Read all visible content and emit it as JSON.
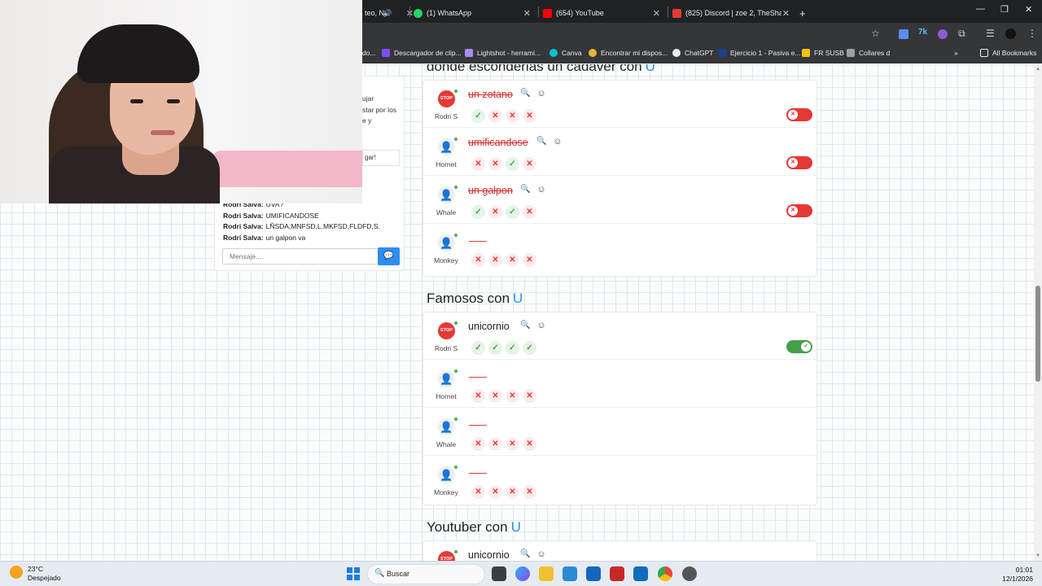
{
  "browser": {
    "tabs": [
      {
        "label": "teo, N"
      },
      {
        "label": "(1) WhatsApp"
      },
      {
        "label": "(654) YouTube"
      },
      {
        "label": "(825) Discord | zoe 2, TheShado"
      }
    ],
    "new_tab": "+",
    "bookmarks": [
      {
        "label": "do..."
      },
      {
        "label": "Descargador de clip..."
      },
      {
        "label": "Lightshot - herrami..."
      },
      {
        "label": "Canva"
      },
      {
        "label": "Encontrar mi dispos..."
      },
      {
        "label": "ChatGPT"
      },
      {
        "label": "Ejercicio 1 - Pasiva e..."
      },
      {
        "label": "FR SUSB"
      },
      {
        "label": "Collares d"
      }
    ],
    "all_bookmarks": "All Bookmarks",
    "colors": {
      "tabbar": "#202124",
      "toolbar": "#35363a"
    }
  },
  "chat": {
    "lines": [
      {
        "user": "Rodri Salva:",
        "text": "UVA?"
      },
      {
        "user": "Rodri Salva:",
        "text": "UMIFICANDOSE"
      },
      {
        "user": "Rodri Salva:",
        "text": "LÑSDA,MNFSD,L.MKFSD,FLDFD,S."
      },
      {
        "user": "Rodri Salva:",
        "text": "un galpon va"
      }
    ],
    "input_placeholder": "Mensaje....",
    "peek_lines": [
      "ujar",
      "star por los",
      "e y"
    ],
    "peek_box": "gar!"
  },
  "sections": [
    {
      "title": "donde esconderias un cadaver con",
      "letter": "U",
      "rows": [
        {
          "player": "Rodri S",
          "answer": "un zotano",
          "status": "rejected",
          "votes": [
            "yes",
            "no",
            "no",
            "no"
          ],
          "toggle": "off"
        },
        {
          "player": "Hornet",
          "answer": "umificandose",
          "status": "rejected",
          "votes": [
            "no",
            "no",
            "yes",
            "no"
          ],
          "toggle": "off"
        },
        {
          "player": "Whale",
          "answer": "un galpon",
          "status": "rejected",
          "votes": [
            "yes",
            "no",
            "yes",
            "no"
          ],
          "toggle": "off"
        },
        {
          "player": "Monkey",
          "answer": "",
          "status": "empty",
          "votes": [
            "no",
            "no",
            "no",
            "no"
          ],
          "toggle": "none"
        }
      ]
    },
    {
      "title": "Famosos con",
      "letter": "U",
      "rows": [
        {
          "player": "Rodri S",
          "answer": "unicornio",
          "status": "accepted",
          "votes": [
            "yes",
            "yes",
            "yes",
            "yes"
          ],
          "toggle": "on"
        },
        {
          "player": "Hornet",
          "answer": "",
          "status": "empty",
          "votes": [
            "no",
            "no",
            "no",
            "no"
          ],
          "toggle": "none"
        },
        {
          "player": "Whale",
          "answer": "",
          "status": "empty",
          "votes": [
            "no",
            "no",
            "no",
            "no"
          ],
          "toggle": "none"
        },
        {
          "player": "Monkey",
          "answer": "",
          "status": "empty",
          "votes": [
            "no",
            "no",
            "no",
            "no"
          ],
          "toggle": "none"
        }
      ]
    },
    {
      "title": "Youtuber con",
      "letter": "U",
      "rows": [
        {
          "player": "Rodri S",
          "answer": "unicornio",
          "status": "accepted",
          "votes": [],
          "toggle": "none"
        }
      ]
    }
  ],
  "vote_marks": {
    "yes": "✓",
    "no": "✕"
  },
  "taskbar": {
    "weather_temp": "23°C",
    "weather_desc": "Despejado",
    "search_label": "Buscar",
    "time": "01:01",
    "date": "12/1/2026"
  }
}
